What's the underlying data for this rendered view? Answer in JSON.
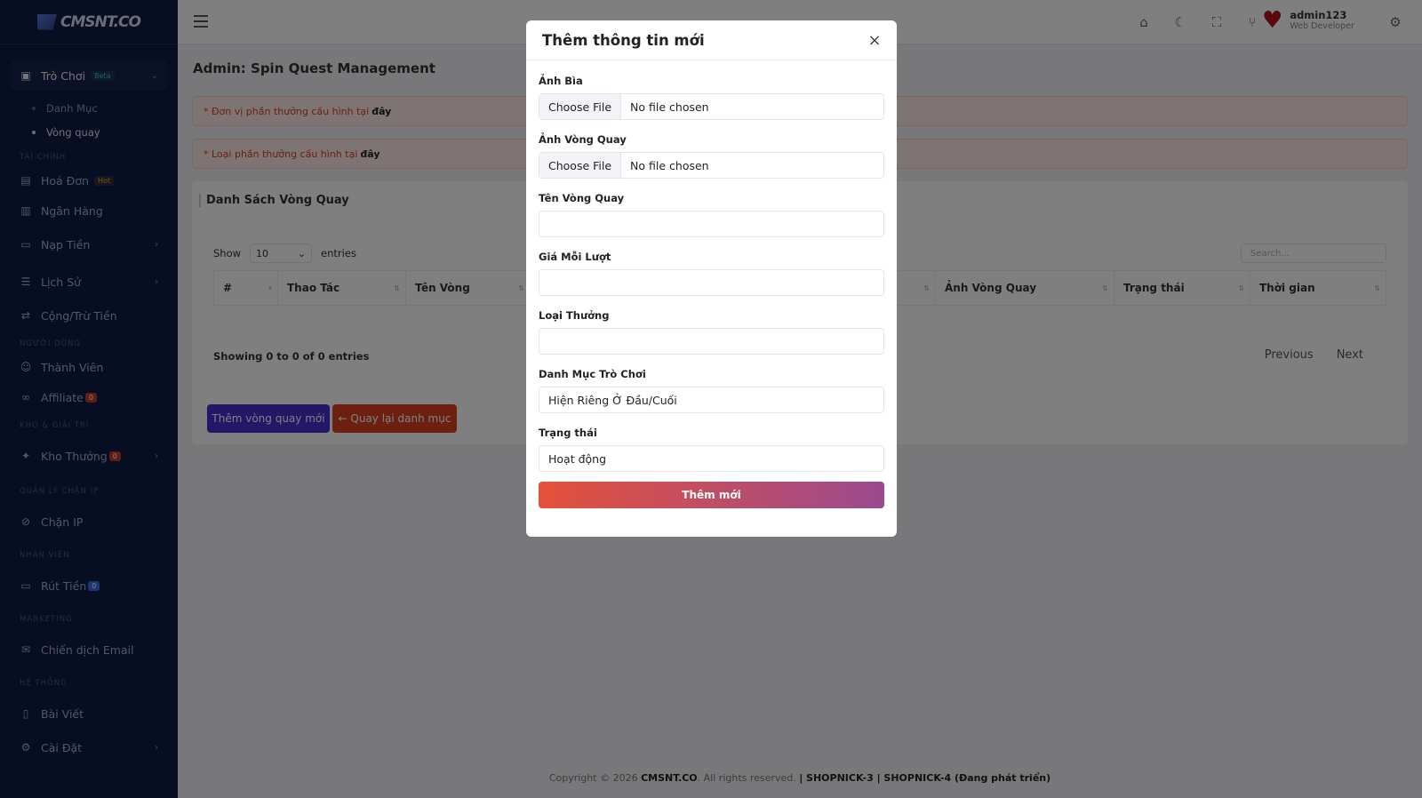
{
  "sidebar": {
    "logo": "CMSNT.CO",
    "items": [
      {
        "label": "Trò Chơi",
        "badge": "Beta"
      },
      {
        "label": "Danh Mục"
      },
      {
        "label": "Vòng quay"
      },
      {
        "label": "Hoá Đơn",
        "badge": "Hot"
      },
      {
        "label": "Ngân Hàng"
      },
      {
        "label": "Nạp Tiền"
      },
      {
        "label": "Lịch Sử"
      },
      {
        "label": "Cộng/Trừ Tiền"
      },
      {
        "label": "Thành Viên"
      },
      {
        "label": "Affiliate",
        "badge": "0"
      },
      {
        "label": "Kho Thưởng",
        "badge": "0"
      },
      {
        "label": "Chặn IP"
      },
      {
        "label": "Rút Tiền",
        "badge": "0"
      },
      {
        "label": "Chiến dịch Email"
      },
      {
        "label": "Bài Viết"
      },
      {
        "label": "Cài Đặt"
      }
    ],
    "sections": [
      "TÀI CHÍNH",
      "NGƯỜI DÙNG",
      "KHO & GIẢI TRÍ",
      "QUẢN LÝ CHẶN IP",
      "NHÂN VIÊN",
      "MARKETING",
      "HỆ THỐNG"
    ]
  },
  "header": {
    "username": "admin123",
    "role": "Web Developer"
  },
  "main": {
    "page_title": "Admin: Spin Quest Management",
    "alerts": [
      {
        "text": "* Đơn vị phần thưởng cấu hình tại",
        "link": "đây"
      },
      {
        "text": "* Loại phần thưởng cấu hình tại",
        "link": "đây"
      }
    ],
    "card_title": "Danh Sách Vòng Quay",
    "show_label": "Show",
    "entries_value": "10",
    "entries_label": "entries",
    "search_placeholder": "Search...",
    "columns": [
      "#",
      "Thao Tác",
      "Tên Vòng",
      "",
      "Ảnh Vòng Quay",
      "Trạng thái",
      "Thời gian"
    ],
    "info": "Showing 0 to 0 of 0 entries",
    "prev": "Previous",
    "next": "Next",
    "btn_add": "Thêm vòng quay mới",
    "btn_back": "← Quay lại danh mục"
  },
  "footer": {
    "copyright": "Copyright © 2026",
    "brand": "CMSNT.CO",
    "rights": ". All rights reserved.",
    "versions": "| SHOPNICK-3 | SHOPNICK-4 (Đang phát triển)"
  },
  "modal": {
    "title": "Thêm thông tin mới",
    "fields": {
      "cover_label": "Ảnh Bìa",
      "wheel_label": "Ảnh Vòng Quay",
      "file_button": "Choose File",
      "file_status": "No file chosen",
      "name_label": "Tên Vòng Quay",
      "price_label": "Giá Mỗi Lượt",
      "reward_type_label": "Loại Thưởng",
      "category_label": "Danh Mục Trò Chơi",
      "category_value": "Hiện Riêng Ở Đầu/Cuối",
      "status_label": "Trạng thái",
      "status_value": "Hoạt động"
    },
    "submit": "Thêm mới"
  }
}
